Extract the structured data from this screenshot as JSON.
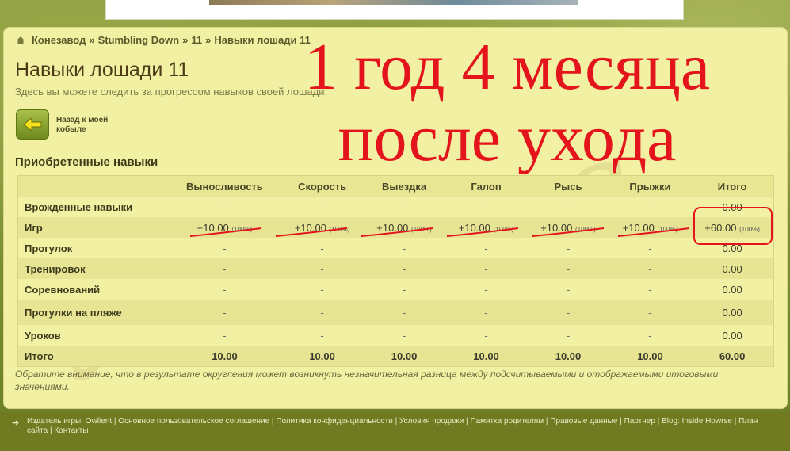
{
  "breadcrumb": {
    "items": [
      "Конезавод",
      "Stumbling Down",
      "11",
      "Навыки лошади 11"
    ],
    "sep": "»"
  },
  "page": {
    "title": "Навыки лошади 11",
    "subtitle": "Здесь вы можете следить за прогрессом навыков своей лошади.",
    "back_label": "Назад к моей кобыле",
    "section_title": "Приобретенные навыки"
  },
  "overlay": {
    "line1": "1 год 4 месяца",
    "line2": "после ухода"
  },
  "table": {
    "headers": [
      "",
      "Выносливость",
      "Скорость",
      "Выездка",
      "Галоп",
      "Рысь",
      "Прыжки",
      "Итого"
    ],
    "rows": [
      {
        "label": "Врожденные навыки",
        "cells": [
          "-",
          "-",
          "-",
          "-",
          "-",
          "-"
        ],
        "total": "0.00"
      },
      {
        "label": "Игр",
        "cells": [
          "+10.00",
          "+10.00",
          "+10.00",
          "+10.00",
          "+10.00",
          "+10.00"
        ],
        "pct": "(100%)",
        "total": "+60.00",
        "total_pct": "(100%)"
      },
      {
        "label": "Прогулок",
        "cells": [
          "-",
          "-",
          "-",
          "-",
          "-",
          "-"
        ],
        "total": "0.00"
      },
      {
        "label": "Тренировок",
        "cells": [
          "-",
          "-",
          "-",
          "-",
          "-",
          "-"
        ],
        "total": "0.00"
      },
      {
        "label": "Соревнований",
        "cells": [
          "-",
          "-",
          "-",
          "-",
          "-",
          "-"
        ],
        "total": "0.00"
      },
      {
        "label": "Прогулки на пляже",
        "cells": [
          "-",
          "-",
          "-",
          "-",
          "-",
          "-"
        ],
        "total": "0.00"
      },
      {
        "label": "Уроков",
        "cells": [
          "-",
          "-",
          "-",
          "-",
          "-",
          "-"
        ],
        "total": "0.00"
      },
      {
        "label": "Итого",
        "cells": [
          "10.00",
          "10.00",
          "10.00",
          "10.00",
          "10.00",
          "10.00"
        ],
        "total": "60.00"
      }
    ]
  },
  "note": "Обратите внимание, что в результате округления может возникнуть незначительная разница между подсчитываемыми и отображаемыми итоговыми значениями.",
  "footer": {
    "links": [
      "Издатель игры: Owlient",
      "Основное пользовательское соглашение",
      "Политика конфиденциальности",
      "Условия продажи",
      "Памятка родителям",
      "Правовые данные",
      "Партнер",
      "Blog: Inside Howrse",
      "План сайта",
      "Контакты"
    ]
  },
  "colors": {
    "overlay_red": "#e3141b",
    "panel_bg": "#f2f0a2"
  }
}
